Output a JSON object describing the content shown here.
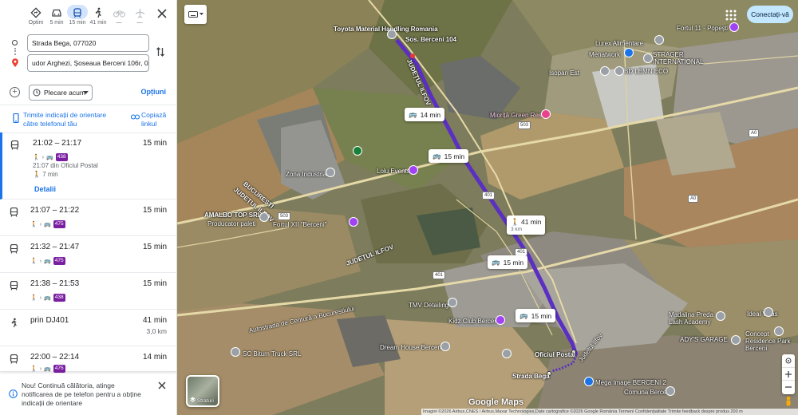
{
  "modes": [
    {
      "label": "Optim",
      "icon": "diamond-route-icon"
    },
    {
      "label": "5 min",
      "icon": "car-icon"
    },
    {
      "label": "15 min",
      "icon": "transit-icon",
      "active": true
    },
    {
      "label": "41 min",
      "icon": "walk-icon"
    },
    {
      "label": "—",
      "icon": "bike-icon"
    },
    {
      "label": "—",
      "icon": "flight-icon"
    }
  ],
  "origin": "Strada Bega, 077020",
  "destination": "udor Arghezi, Șoseaua Berceni 106r, 041",
  "depart_label": "Plecare acum",
  "options_label": "Opțiuni",
  "send_to_phone": "Trimite indicații de orientare către telefonul tău",
  "copy_link": "Copiază linkul",
  "routes": [
    {
      "times": "21:02 – 21:17",
      "duration": "15 min",
      "bus": "438",
      "detail_line": "21:07 din Oficiul Postal",
      "walk": "7 min",
      "details_label": "Detalii"
    },
    {
      "times": "21:07 – 21:22",
      "duration": "15 min",
      "bus": "475"
    },
    {
      "times": "21:32 – 21:47",
      "duration": "15 min",
      "bus": "475"
    },
    {
      "times": "21:38 – 21:53",
      "duration": "15 min",
      "bus": "438"
    },
    {
      "times": "prin DJ401",
      "duration": "41 min",
      "distance": "3,0 km"
    },
    {
      "times": "22:00 – 22:14",
      "duration": "14 min",
      "bus": "475"
    }
  ],
  "notification": "Nou! Continuă călătoria, atinge notificarea de pe telefon pentru a obține indicații de orientare",
  "signin_label": "Conectați-vă",
  "layers_label": "Straturi",
  "brand": "Google Maps",
  "attribution": "Imagini ©2026 Airbus,CNES / Airbus,Maxar Technologies,Date cartografice ©2026 Google   România   Termeni   Confidențialitate   Trimite feedback despre produs   200 m",
  "map": {
    "route_labels": [
      {
        "text": "14 min"
      },
      {
        "text": "15 min"
      },
      {
        "text": "41 min",
        "sub": "3 km"
      },
      {
        "text": "15 min"
      },
      {
        "text": "15 min"
      }
    ],
    "places": {
      "toyota": "Toyota Material Handling Romania",
      "sos_berceni": "Sos. Berceni 104",
      "judetul_ilfov": "JUDEȚUL ILFOV",
      "lurex": "Lurex Alimentare",
      "menatwork": "Menatwork",
      "fortul11": "Fortul 11 - Popești",
      "strager": "STRAGER INTERNATIONAL",
      "isopan": "Isopan Est",
      "bd_lemn": "BD LEMN ECO",
      "miorita": "Mioriță Green Resort",
      "zona_ind": "Zona Industriala",
      "lolu": "Lolu Events",
      "bucuresti": "BUCUREȘTI",
      "judetul_ilfov2": "JUDEȚUL ILFOV",
      "amalbo": "AMALBO TOP SRL",
      "amalbo_sub": "Producator paleti",
      "fortul12": "Fortul XII \"Berceni\"",
      "judetul_ilfov3": "JUDEȚUL ILFOV",
      "autostrada": "Autostrada de Centură a Bucureștiului",
      "tmv": "TMV Detailing",
      "kidz": "Kidz Club Berceni",
      "dream": "Dream House Berceni",
      "bitum": "SC Bitum Truck SRL",
      "oficiul": "Oficiul Postal",
      "strada_bega": "Strada Bega",
      "mega": "Mega Image BERCENI 2",
      "comuna": "Comuna Berceni",
      "madalina": "Madalina Preda Lash Academy",
      "ideal": "Ideal Villas",
      "ady": "ADY'S GARAGE",
      "concept": "Concept Residence Park Berceni",
      "ilfov_road": "Judetul Ilfov"
    },
    "shields": [
      "503",
      "401",
      "401",
      "503",
      "401",
      "A0",
      "A0"
    ]
  }
}
